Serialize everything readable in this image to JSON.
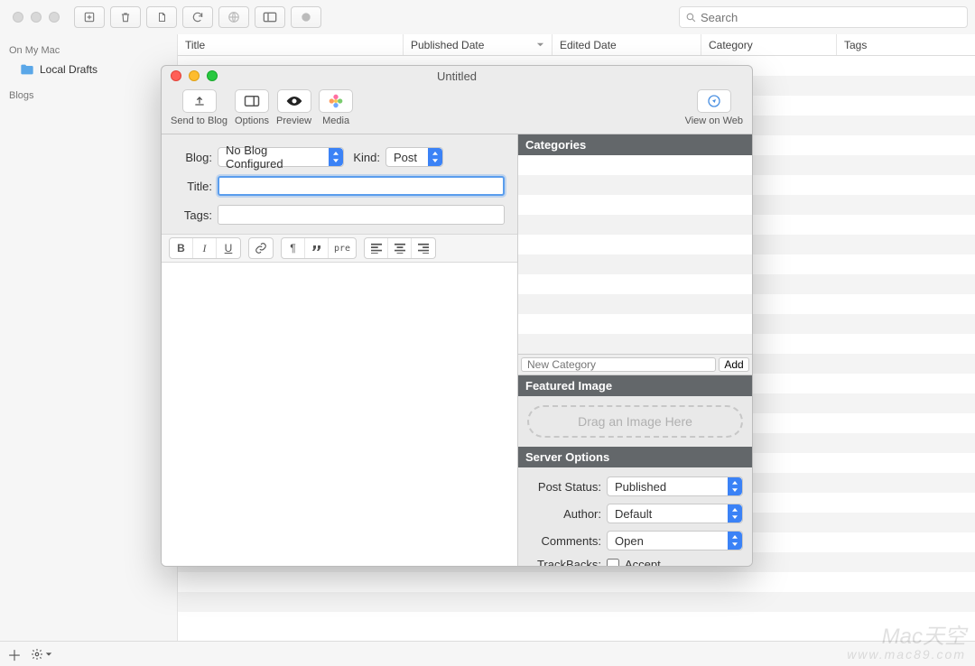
{
  "main": {
    "search_placeholder": "Search",
    "sidebar": {
      "section_local": "On My Mac",
      "local_drafts": "Local Drafts",
      "section_blogs": "Blogs"
    },
    "columns": {
      "title": "Title",
      "published": "Published Date",
      "edited": "Edited Date",
      "category": "Category",
      "tags": "Tags"
    }
  },
  "editor": {
    "window_title": "Untitled",
    "toolbar": {
      "send": "Send to Blog",
      "options": "Options",
      "preview": "Preview",
      "media": "Media",
      "view_web": "View on Web"
    },
    "form": {
      "blog_label": "Blog:",
      "blog_value": "No Blog Configured",
      "kind_label": "Kind:",
      "kind_value": "Post",
      "title_label": "Title:",
      "title_value": "",
      "tags_label": "Tags:",
      "tags_value": ""
    },
    "format": {
      "pre": "pre"
    },
    "right": {
      "categories_head": "Categories",
      "new_category_placeholder": "New Category",
      "add_label": "Add",
      "featured_head": "Featured Image",
      "featured_drop": "Drag an Image Here",
      "server_head": "Server Options",
      "post_status_label": "Post Status:",
      "post_status_value": "Published",
      "author_label": "Author:",
      "author_value": "Default",
      "comments_label": "Comments:",
      "comments_value": "Open",
      "trackbacks_label": "TrackBacks:",
      "trackbacks_accept": "Accept"
    }
  },
  "watermark": {
    "line1": "Mac天空",
    "line2": "www.mac89.com"
  }
}
